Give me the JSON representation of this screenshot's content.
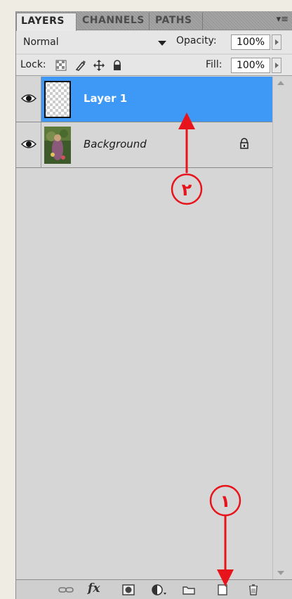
{
  "tabs": [
    {
      "label": "LAYERS",
      "active": true
    },
    {
      "label": "CHANNELS",
      "active": false
    },
    {
      "label": "PATHS",
      "active": false
    }
  ],
  "blend": {
    "mode": "Normal",
    "opacity_label": "Opacity:",
    "opacity_value": "100%"
  },
  "lock": {
    "label": "Lock:",
    "fill_label": "Fill:",
    "fill_value": "100%"
  },
  "layers": [
    {
      "name": "Layer 1",
      "selected": true,
      "visible": true,
      "thumbnail": "transparent-checker"
    },
    {
      "name": "Background",
      "selected": false,
      "visible": true,
      "thumbnail": "photo",
      "locked": true
    }
  ],
  "footer_icons": [
    "link-icon",
    "fx-icon",
    "layer-mask-icon",
    "adjustment-layer-icon",
    "folder-icon",
    "new-layer-icon",
    "trash-icon"
  ],
  "footer_fx": "fx",
  "annotations": [
    {
      "label": "٢",
      "points_to": "Layer 1"
    },
    {
      "label": "١",
      "points_to": "new-layer-icon"
    }
  ],
  "colors": {
    "selection": "#3d99f5",
    "arrow": "#e8141c",
    "panel": "#d6d6d6"
  }
}
